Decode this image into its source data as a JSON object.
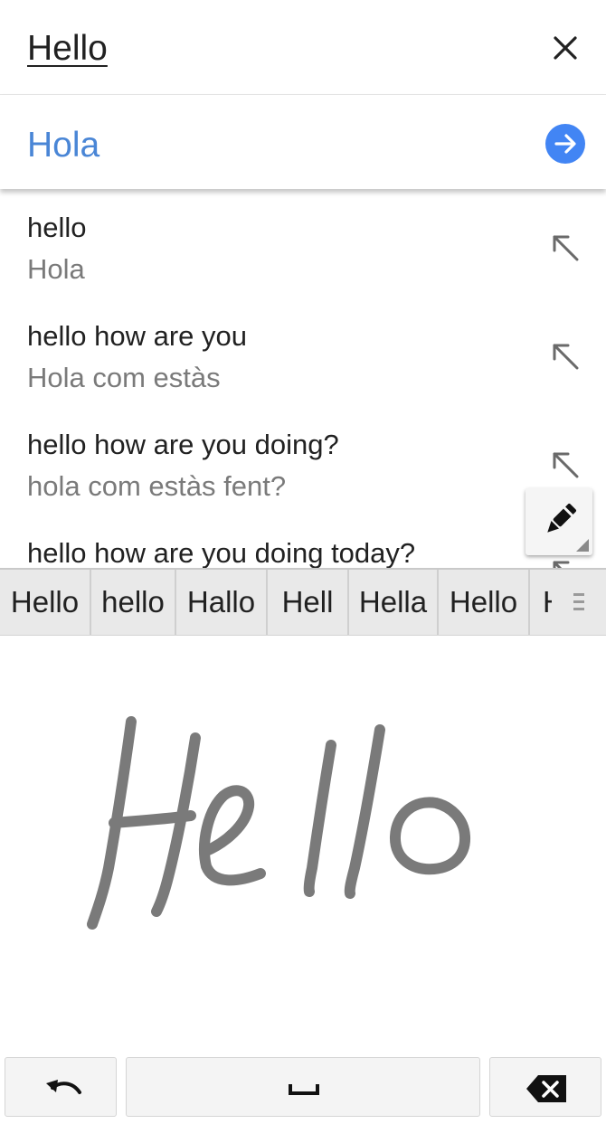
{
  "input": {
    "text": "Hello",
    "clear_icon": "close-icon"
  },
  "translation": {
    "text": "Hola",
    "go_icon": "arrow-right-icon",
    "accent_color": "#4285f4"
  },
  "suggestions": [
    {
      "source": "hello",
      "target": "Hola"
    },
    {
      "source": "hello how are you",
      "target": "Hola com estàs"
    },
    {
      "source": "hello how are you doing?",
      "target": "hola com estàs fent?"
    },
    {
      "source": "hello how are you doing today?",
      "target": ""
    }
  ],
  "pen_button": {
    "icon": "pen-icon"
  },
  "candidates": [
    "Hello",
    "hello",
    "Hallo",
    "Hell",
    "Hella",
    "Hello",
    "H"
  ],
  "handwriting": {
    "ink_color": "#7a7a7a"
  },
  "keys": {
    "undo_icon": "undo-icon",
    "space_icon": "space-icon",
    "backspace_icon": "backspace-icon"
  }
}
